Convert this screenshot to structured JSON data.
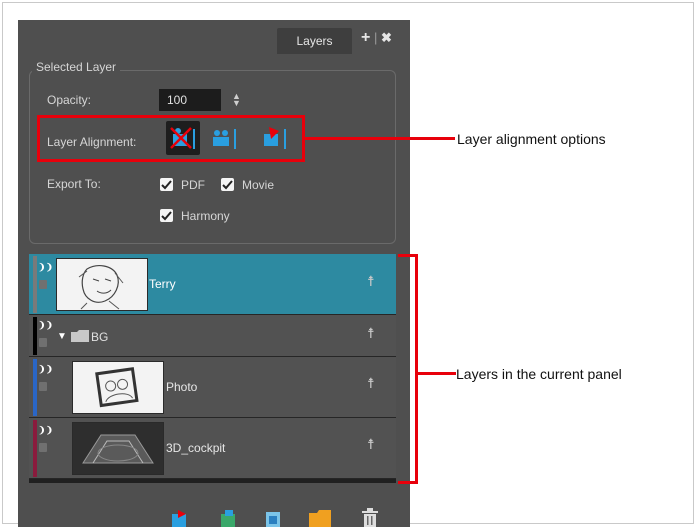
{
  "panel": {
    "tab_label": "Layers",
    "add_symbol": "+",
    "close_symbol": "✖",
    "sep_symbol": "|"
  },
  "selected_layer": {
    "group_label": "Selected Layer",
    "opacity_label": "Opacity:",
    "opacity_value": "100",
    "spin_symbol": "▲▼",
    "alignment_label": "Layer Alignment:",
    "export_label": "Export To:",
    "export_pdf": "PDF",
    "export_movie": "Movie",
    "export_harmony": "Harmony",
    "export_pdf_checked": true,
    "export_movie_checked": true,
    "export_harmony_checked": true
  },
  "layers": [
    {
      "name": "Terry",
      "selected": true,
      "color": "#7a7a7a"
    },
    {
      "name": "BG",
      "selected": false,
      "color": "#000000",
      "is_folder": true,
      "expanded": true
    },
    {
      "name": "Photo",
      "selected": false,
      "color": "#2a66c6"
    },
    {
      "name": "3D_cockpit",
      "selected": false,
      "color": "#8a1b3d"
    }
  ],
  "callouts": {
    "alignment": "Layer alignment options",
    "layers": "Layers in the current panel"
  },
  "icons": {
    "eye": "eye-icon",
    "lock": "lock-icon",
    "person": "person-icon"
  },
  "colors": {
    "panel_bg": "#4f4f4f",
    "selected_row": "#2d8aa1",
    "callout_red": "#e8000b"
  }
}
